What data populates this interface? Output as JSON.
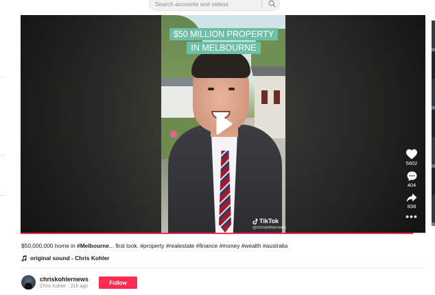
{
  "search": {
    "placeholder": "Search accounts and videos",
    "icon": "search-icon"
  },
  "video": {
    "overlay_caption": "$50 MILLION PROPERTY IN MELBOURNE",
    "watermark_brand": "TikTok",
    "watermark_handle": "@chriskohlernews",
    "play_icon": "play-icon",
    "progress": 0.97,
    "colors": {
      "caption_bg": "#6fbfa6",
      "progress": "#fe2c55"
    }
  },
  "actions": {
    "likes": "5602",
    "comments": "404",
    "shares": "838",
    "icons": [
      "heart-icon",
      "comment-icon",
      "share-icon",
      "more-icon"
    ]
  },
  "post": {
    "description_plain": "$50,000,000 home in ",
    "description_tag1": "#Melbourne",
    "description_mid": "... first look. ",
    "hashtags": "#property #realestate #finance #money #wealth #australia",
    "sound": "original sound - Chris Kohler"
  },
  "author": {
    "username": "chriskohlernews",
    "meta": "Chris Kohler · 21h ago",
    "follow_label": "Follow",
    "follow_color": "#fe2c55"
  }
}
